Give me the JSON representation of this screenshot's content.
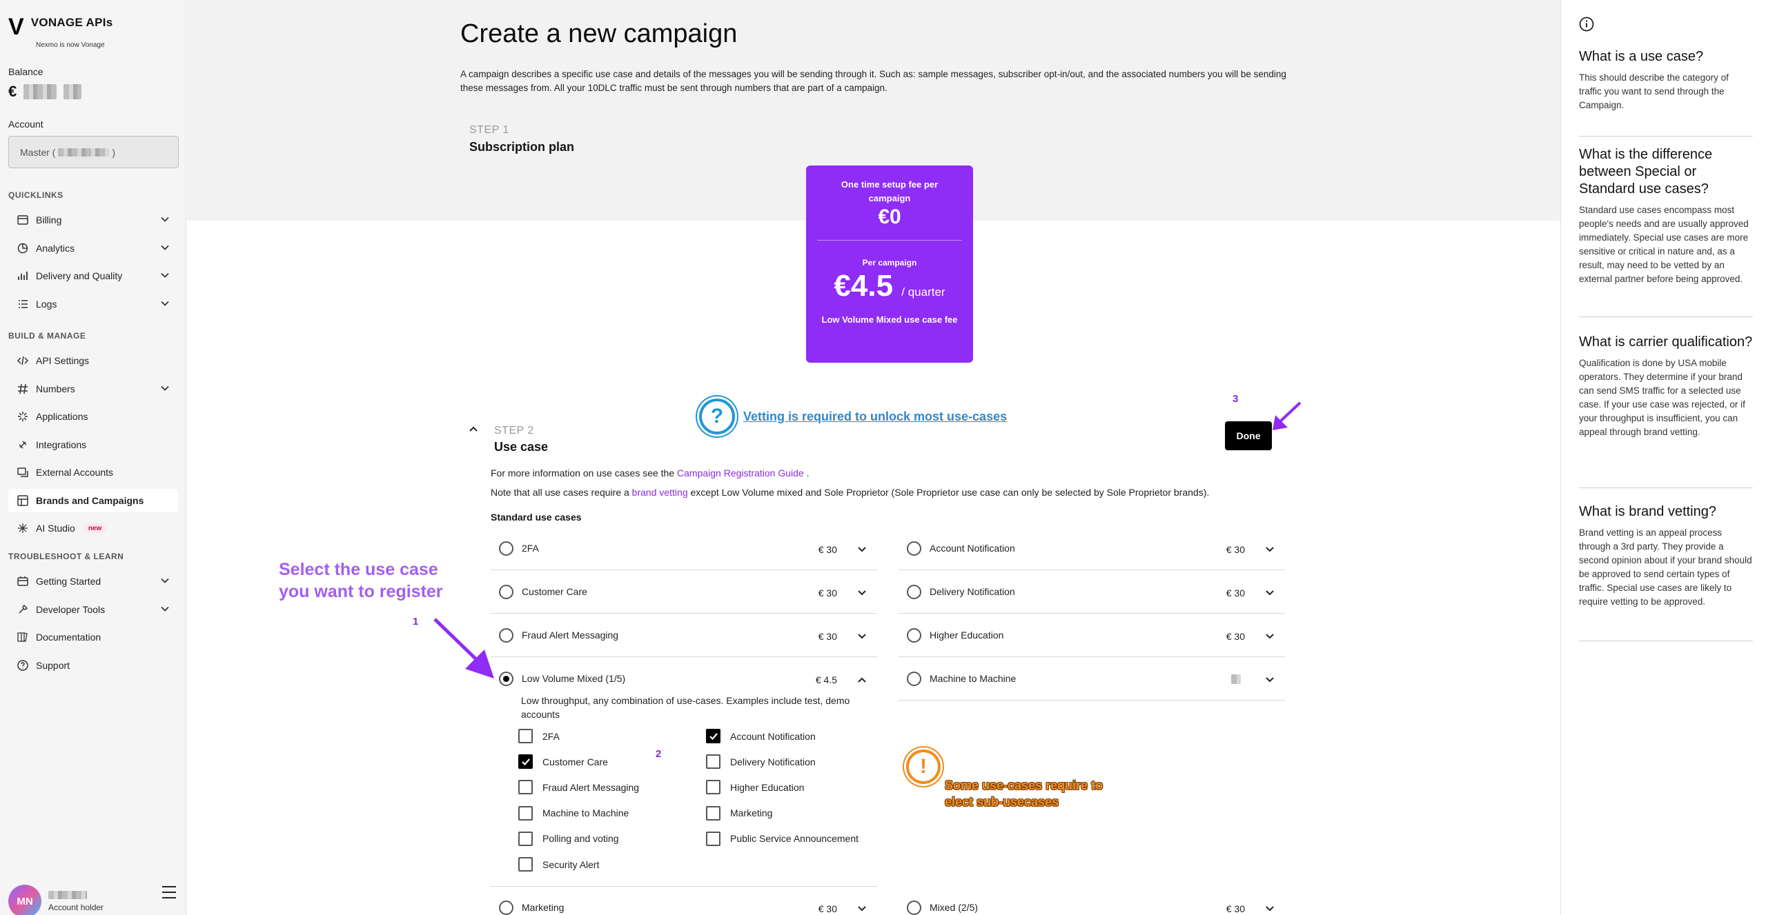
{
  "brand": {
    "title": "VONAGE APIs",
    "subtitle": "Nexmo is now Vonage"
  },
  "sidebar": {
    "balance_label": "Balance",
    "currency_symbol": "€",
    "account_label": "Account",
    "account_value_prefix": "Master (",
    "account_value_suffix": ")",
    "quicklinks_label": "QUICKLINKS",
    "build_label": "BUILD & MANAGE",
    "troubleshoot_label": "TROUBLESHOOT & LEARN",
    "quicklinks": [
      "Billing",
      "Analytics",
      "Delivery and Quality",
      "Logs"
    ],
    "build": [
      "API Settings",
      "Numbers",
      "Applications",
      "Integrations",
      "External Accounts",
      "Brands and Campaigns",
      "AI Studio"
    ],
    "ai_badge": "new",
    "troubleshoot": [
      "Getting Started",
      "Developer Tools",
      "Documentation",
      "Support"
    ],
    "user_initials": "MN",
    "user_role": "Account holder"
  },
  "main": {
    "title": "Create a new campaign",
    "description": "A campaign describes a specific use case and details of the messages you will be sending through it. Such as: sample messages, subscriber opt-in/out, and the associated numbers you will be sending these messages from. All your 10DLC traffic must be sent through numbers that are part of a campaign.",
    "step1": {
      "num": "STEP 1",
      "title": "Subscription plan"
    },
    "plan": {
      "setup_label": "One time setup fee per campaign",
      "setup_value": "€0",
      "per_label": "Per campaign",
      "price": "€4.5",
      "period": "/ quarter",
      "fee_label": "Low Volume Mixed use case fee"
    },
    "step2": {
      "num": "STEP 2",
      "title": "Use case"
    },
    "vetting_text": "Vetting is required to unlock most use-cases",
    "done_label": "Done",
    "info1_pre": "For more information on use cases see the ",
    "info1_link": "Campaign Registration Guide",
    "info1_post": " .",
    "info2_pre": "Note that all use cases require a ",
    "info2_link": "brand vetting",
    "info2_post": " except Low Volume mixed and Sole Proprietor (Sole Proprietor use case can only be selected by Sole Proprietor brands).",
    "standard_label": "Standard use cases",
    "left_cases": [
      {
        "name": "2FA",
        "price": "€ 30"
      },
      {
        "name": "Customer Care",
        "price": "€ 30"
      },
      {
        "name": "Fraud Alert Messaging",
        "price": "€ 30"
      },
      {
        "name": "Low Volume Mixed (1/5)",
        "price": "€ 4.5"
      }
    ],
    "right_cases": [
      {
        "name": "Account Notification",
        "price": "€ 30"
      },
      {
        "name": "Delivery Notification",
        "price": "€ 30"
      },
      {
        "name": "Higher Education",
        "price": "€ 30"
      },
      {
        "name": "Machine to Machine",
        "price": ""
      }
    ],
    "expanded_desc": "Low throughput, any combination of use-cases. Examples include test, demo accounts",
    "sub_left": [
      {
        "name": "2FA",
        "checked": false
      },
      {
        "name": "Customer Care",
        "checked": true
      },
      {
        "name": "Fraud Alert Messaging",
        "checked": false
      },
      {
        "name": "Machine to Machine",
        "checked": false
      },
      {
        "name": "Polling and voting",
        "checked": false
      },
      {
        "name": "Security Alert",
        "checked": false
      }
    ],
    "sub_right": [
      {
        "name": "Account Notification",
        "checked": true
      },
      {
        "name": "Delivery Notification",
        "checked": false
      },
      {
        "name": "Higher Education",
        "checked": false
      },
      {
        "name": "Marketing",
        "checked": false
      },
      {
        "name": "Public Service Announcement",
        "checked": false
      }
    ],
    "bottom_left": {
      "name": "Marketing",
      "price": "€ 30"
    },
    "bottom_right": {
      "name": "Mixed (2/5)",
      "price": "€ 30"
    }
  },
  "annotations": {
    "n1": "1",
    "n2": "2",
    "n3": "3",
    "select_text": "Select the use case you want to register",
    "warn_text": "Some use-cases require to elect sub-usecases"
  },
  "help": [
    {
      "q": "What is a use case?",
      "a": "This should describe the category of traffic you want to send through the Campaign."
    },
    {
      "q": "What is the difference between Special or Standard use cases?",
      "a": "Standard use cases encompass most people's needs and are usually approved immediately. Special use cases are more sensitive or critical in nature and, as a result, may need to be vetted by an external partner before being approved."
    },
    {
      "q": "What is carrier qualification?",
      "a": "Qualification is done by USA mobile operators. They determine if your brand can send SMS traffic for a selected use case. If your use case was rejected, or if your throughput is insufficient, you can appeal through brand vetting."
    },
    {
      "q": "What is brand vetting?",
      "a": "Brand vetting is an appeal process through a 3rd party. They provide a second opinion about if your brand should be approved to send certain types of traffic. Special use cases are likely to require vetting to be approved."
    }
  ],
  "colors": {
    "accent": "#8f2cf6",
    "vetting": "#2196d8",
    "warning": "#f28c1c"
  }
}
